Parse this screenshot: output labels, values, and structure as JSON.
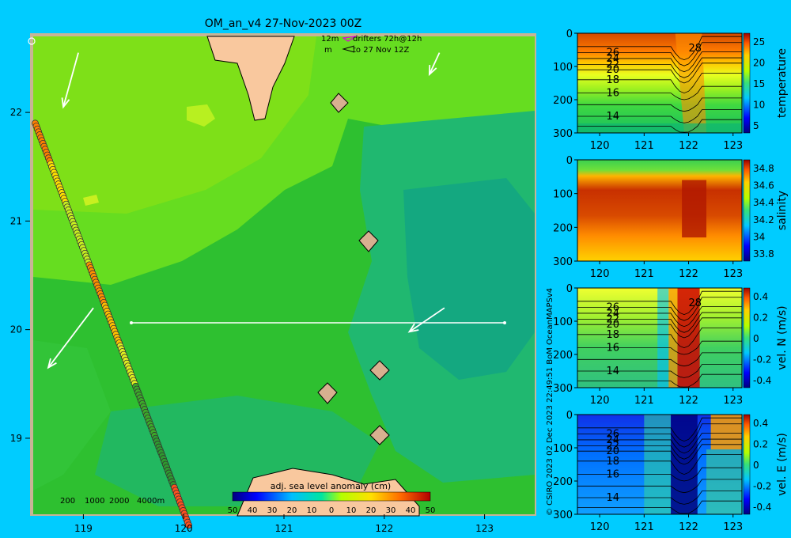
{
  "header": {
    "title": "OM_an_v4  27-Nov-2023 00Z"
  },
  "legend": {
    "depth_label": "12m",
    "depth_label_2": "m",
    "drifters": "drifters 72h@12h",
    "drifters_to": "to 27 Nov 12Z"
  },
  "credit": "© CSIRO 2023   02 Dec 2023 22:49:51 BoM OceanMAPSv4",
  "colors": {
    "background": "#00ccff",
    "land": "#f9c89e",
    "map_frame": "#c8b496",
    "section_line": "#ffffff",
    "arrow": "#ffffff"
  },
  "chart_data": [
    {
      "type": "heatmap",
      "name": "map",
      "title": "OM_an_v4  27-Nov-2023 00Z",
      "xlim": [
        118.5,
        123.5
      ],
      "ylim": [
        18.3,
        22.7
      ],
      "xticks": [
        "119",
        "120",
        "121",
        "122",
        "123"
      ],
      "yticks": [
        "19",
        "20",
        "21",
        "22"
      ],
      "colorbar": {
        "label": "adj. sea level anomaly (cm)",
        "ticks": [
          "-50",
          "-40",
          "-30",
          "-20",
          "-10",
          "0",
          "10",
          "20",
          "30",
          "40",
          "50"
        ],
        "range": [
          -50,
          50
        ]
      },
      "bathymetry_legend": [
        "200",
        "1000",
        "2000",
        "4000m"
      ],
      "section_line": {
        "x": [
          119.5,
          123.2
        ],
        "y": 20.0
      },
      "current_arrows": [
        {
          "x": 118.95,
          "y": 22.55,
          "dx": -0.15,
          "dy": -0.5
        },
        {
          "x": 122.55,
          "y": 22.55,
          "dx": -0.1,
          "dy": -0.2
        },
        {
          "x": 119.1,
          "y": 20.2,
          "dx": -0.45,
          "dy": -0.55
        },
        {
          "x": 122.6,
          "y": 20.2,
          "dx": -0.35,
          "dy": -0.22
        }
      ],
      "drifter_track": {
        "start": [
          118.52,
          21.9
        ],
        "end": [
          120.05,
          18.2
        ],
        "count": 140
      }
    },
    {
      "type": "heatmap",
      "name": "temperature-section",
      "xlabel": "",
      "ylabel": "",
      "colorbar_label": "temperature",
      "xticks": [
        "120",
        "121",
        "122",
        "123"
      ],
      "yticks": [
        "0",
        "100",
        "200",
        "300"
      ],
      "xlim": [
        119.5,
        123.2
      ],
      "ylim": [
        300,
        0
      ],
      "colorbar_ticks": [
        "5",
        "10",
        "15",
        "20",
        "25"
      ],
      "contour_labels": [
        "26",
        "24",
        "22",
        "20",
        "18",
        "16",
        "14",
        "28"
      ]
    },
    {
      "type": "heatmap",
      "name": "salinity-section",
      "colorbar_label": "salinity",
      "xticks": [
        "120",
        "121",
        "122",
        "123"
      ],
      "yticks": [
        "0",
        "100",
        "200",
        "300"
      ],
      "xlim": [
        119.5,
        123.2
      ],
      "ylim": [
        300,
        0
      ],
      "colorbar_ticks": [
        "33.8",
        "34",
        "34.2",
        "34.4",
        "34.6",
        "34.8"
      ]
    },
    {
      "type": "heatmap",
      "name": "vel-n-section",
      "colorbar_label": "vel. N (m/s)",
      "xticks": [
        "120",
        "121",
        "122",
        "123"
      ],
      "yticks": [
        "0",
        "100",
        "200",
        "300"
      ],
      "xlim": [
        119.5,
        123.2
      ],
      "ylim": [
        300,
        0
      ],
      "colorbar_ticks": [
        "-0.4",
        "-0.2",
        "0",
        "0.2",
        "0.4"
      ],
      "contour_labels": [
        "26",
        "24",
        "22",
        "20",
        "18",
        "16",
        "14",
        "28"
      ]
    },
    {
      "type": "heatmap",
      "name": "vel-e-section",
      "colorbar_label": "vel. E (m/s)",
      "xticks": [
        "120",
        "121",
        "122",
        "123"
      ],
      "yticks": [
        "0",
        "100",
        "200",
        "300"
      ],
      "xlim": [
        119.5,
        123.2
      ],
      "ylim": [
        300,
        0
      ],
      "colorbar_ticks": [
        "-0.4",
        "-0.2",
        "0",
        "0.2",
        "0.4"
      ],
      "contour_labels": [
        "26",
        "24",
        "22",
        "20",
        "18",
        "16",
        "14"
      ]
    }
  ]
}
